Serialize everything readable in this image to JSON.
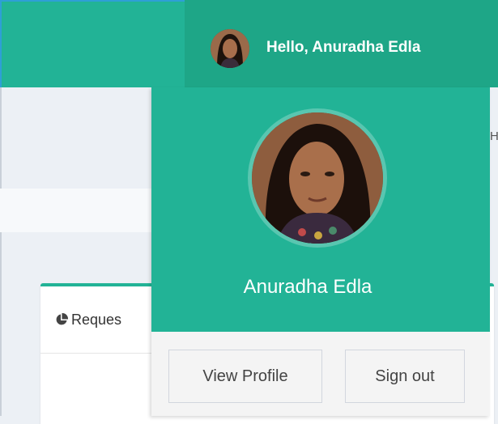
{
  "header": {
    "greeting": "Hello, Anuradha Edla"
  },
  "user_menu": {
    "name": "Anuradha Edla",
    "view_profile_label": "View Profile",
    "sign_out_label": "Sign out"
  },
  "background": {
    "box_title": "Reques",
    "edge_text": "H"
  },
  "colors": {
    "brand": "#22b396",
    "brand_dark": "#1ea687"
  },
  "icons": {
    "box_icon": "pie-chart-icon",
    "avatar": "user-avatar"
  }
}
